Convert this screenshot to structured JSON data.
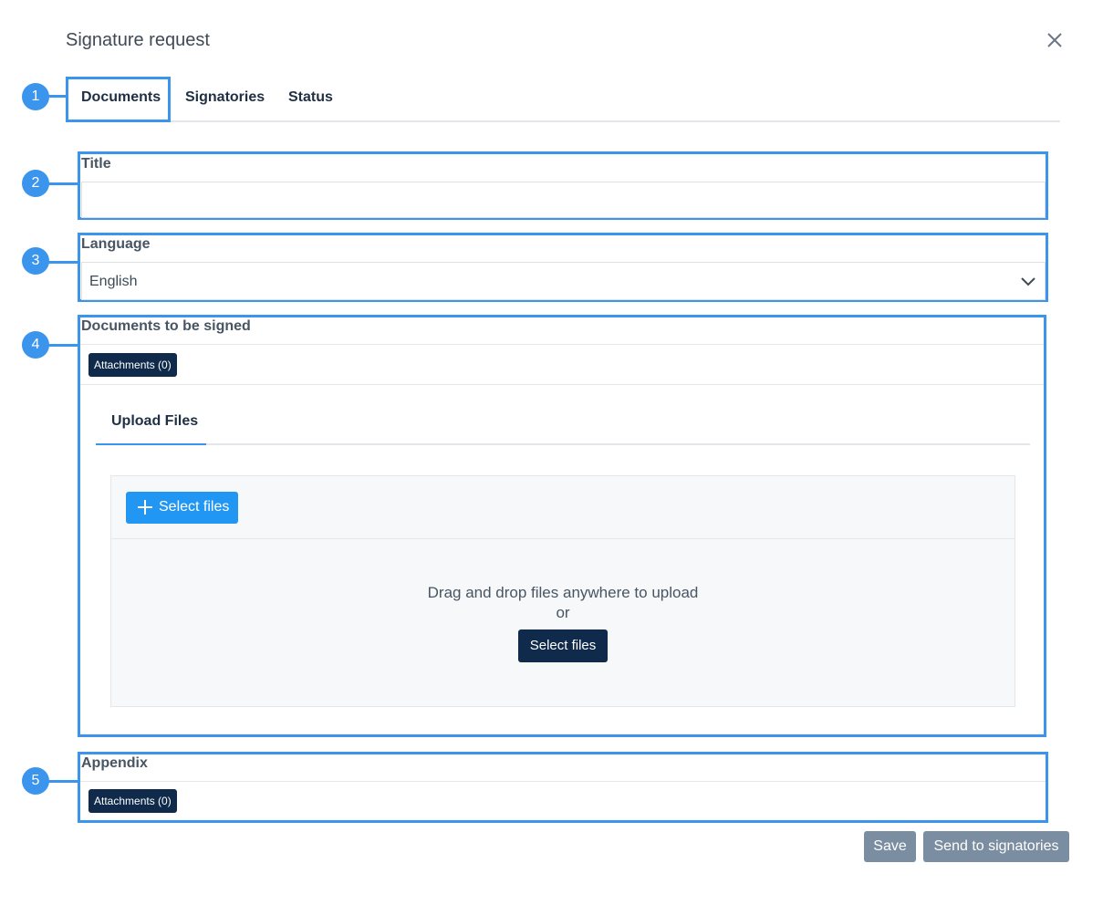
{
  "dialog": {
    "title": "Signature request"
  },
  "tabs": [
    {
      "label": "Documents"
    },
    {
      "label": "Signatories"
    },
    {
      "label": "Status"
    }
  ],
  "callouts": [
    "1",
    "2",
    "3",
    "4",
    "5"
  ],
  "fields": {
    "title_label": "Title",
    "title_value": "",
    "language_label": "Language",
    "language_value": "English"
  },
  "documents": {
    "label": "Documents to be signed",
    "attachments_label": "Attachments (0)",
    "upload_tab": "Upload Files",
    "select_files_button": "Select files",
    "drop_text": "Drag and drop files anywhere to upload",
    "or_text": "or",
    "select_files_button_2": "Select files"
  },
  "appendix": {
    "label": "Appendix",
    "attachments_label": "Attachments (0)"
  },
  "footer": {
    "save_label": "Save",
    "send_label": "Send to signatories"
  },
  "colors": {
    "accent": "#3b95ec",
    "navy": "#0f2a4a",
    "primary": "#2196f3",
    "disabled": "#7b8da0"
  },
  "icons": {
    "close": "close-icon",
    "chevron": "chevron-down-icon",
    "plus": "plus-icon"
  }
}
